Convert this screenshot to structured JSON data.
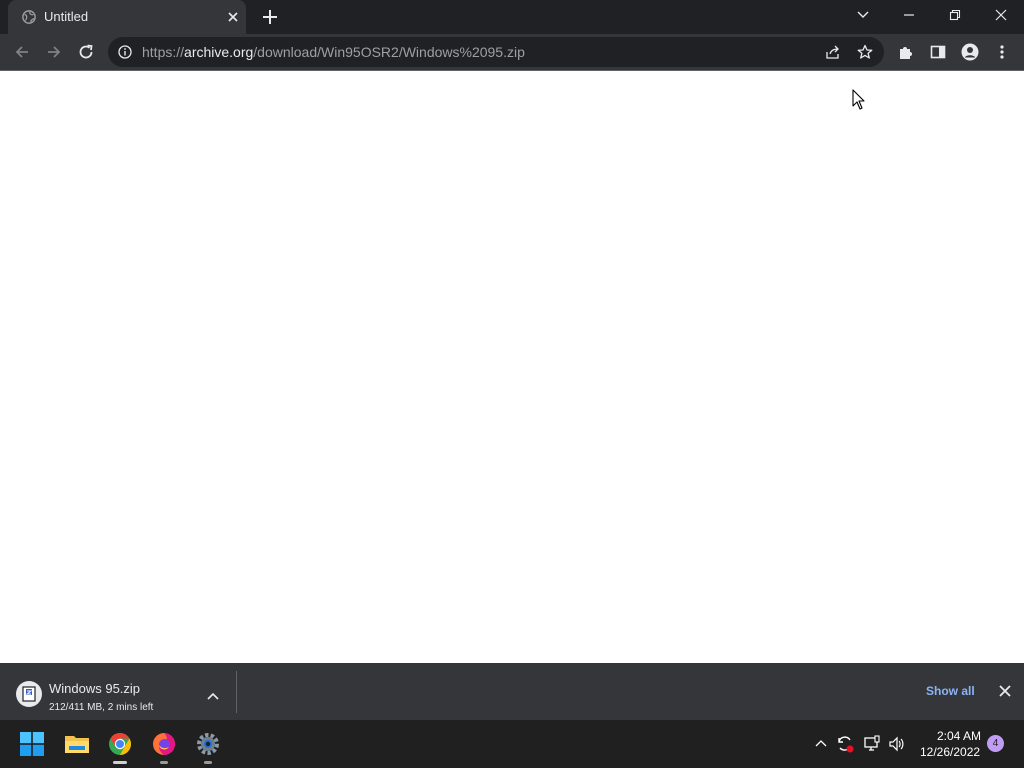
{
  "browser": {
    "tab": {
      "title": "Untitled"
    },
    "omnibox": {
      "scheme": "https://",
      "domain": "archive.org",
      "path": "/download/Win95OSR2/Windows%2095.zip"
    }
  },
  "download_shelf": {
    "file_name": "Windows 95.zip",
    "status": "212/411 MB, 2 mins left",
    "show_all_label": "Show all"
  },
  "taskbar": {
    "time": "2:04 AM",
    "date": "12/26/2022",
    "notification_count": "4",
    "apps": [
      "start-icon",
      "file-explorer-icon",
      "chrome-icon",
      "firefox-icon",
      "settings-icon"
    ]
  },
  "colors": {
    "tab_strip": "#202124",
    "toolbar": "#35363a",
    "accent_link": "#8ab4f8",
    "taskbar": "#202020"
  }
}
